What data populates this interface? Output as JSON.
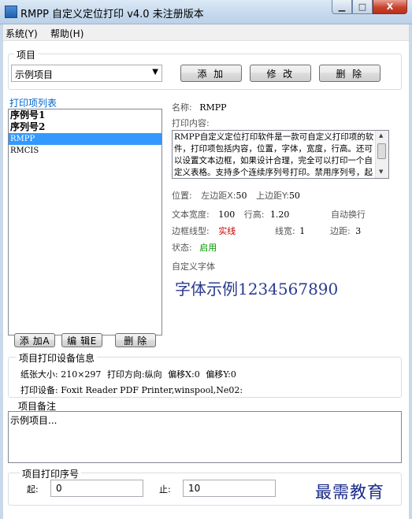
{
  "window": {
    "title": "RMPP 自定义定位打印 v4.0 未注册版本",
    "min_symbol": "▁",
    "max_symbol": "□",
    "close_symbol": "X"
  },
  "menu": [
    {
      "label": "系统(Y)"
    },
    {
      "label": "帮助(H)"
    }
  ],
  "project": {
    "legend": "项目",
    "selected": "示例项目",
    "add_label": "添 加",
    "edit_label": "修 改",
    "delete_label": "删 除"
  },
  "print_list": {
    "title": "打印项列表",
    "items": [
      {
        "label": "序例号1",
        "style": "bold"
      },
      {
        "label": "序列号2",
        "style": "bold"
      },
      {
        "label": "RMPP",
        "style": "selected"
      },
      {
        "label": "RMCIS",
        "style": "small"
      }
    ],
    "add_label": "添 加A",
    "edit_label": "编 辑E",
    "delete_label": "删 除"
  },
  "detail": {
    "name_label": "名称:",
    "name_value": "RMPP",
    "content_label": "打印内容:",
    "content_text": "RMPP自定义定位打印软件是一款可自定义打印项的软件，打印项包括内容，位置，字体，宽度，行高。还可以设置文本边框，如果设计合理，完全可以打印一个自定义表格。支持多个连续序列号打印。禁用序列号，起止之差则为",
    "position_label": "位置:",
    "left_label": "左边距X:",
    "left_value": "50",
    "top_label": "上边距Y:",
    "top_value": "50",
    "width_label": "文本宽度:",
    "width_value": "100",
    "lineheight_label": "行高:",
    "lineheight_value": "1.20",
    "autowrap_label": "自动换行",
    "border_type_label": "边框线型:",
    "border_type_value": "实线",
    "line_width_label": "线宽:",
    "line_width_value": "1",
    "margin_label": "边距:",
    "margin_value": "3",
    "status_label": "状态:",
    "status_value": "启用",
    "custom_font_label": "自定义字体",
    "font_sample": "字体示例1234567890"
  },
  "device": {
    "legend": "项目打印设备信息",
    "paper_label": "纸张大小:",
    "paper_value": "210×297",
    "direction_label": "打印方向:",
    "direction_value": "纵向",
    "offset_x_label": "偏移X:",
    "offset_x_value": "0",
    "offset_y_label": "偏移Y:",
    "offset_y_value": "0",
    "printer_label": "打印设备:",
    "printer_value": "Foxit Reader PDF Printer,winspool,Ne02:"
  },
  "memo": {
    "legend": "项目备注",
    "text": "示例项目..."
  },
  "serial": {
    "legend": "项目打印序号",
    "start_label": "起:",
    "start_value": "0",
    "end_label": "止:",
    "end_value": "10"
  },
  "watermark": "最需教育",
  "colors": {
    "accent_blue": "#0066cc",
    "selection": "#3399ff",
    "border_red": "#cc0000",
    "status_green": "#009900",
    "font_sample": "#2a3a8f"
  }
}
